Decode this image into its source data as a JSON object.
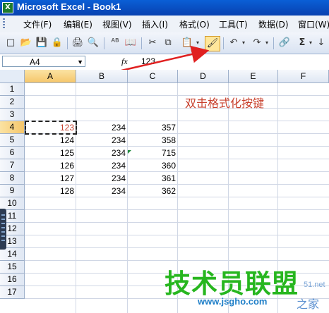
{
  "window": {
    "title": "Microsoft Excel - Book1",
    "app_icon": "X"
  },
  "menu": {
    "items": [
      "文件(F)",
      "编辑(E)",
      "视图(V)",
      "插入(I)",
      "格式(O)",
      "工具(T)",
      "数据(D)",
      "窗口(W)"
    ]
  },
  "toolbar": {
    "icons": [
      "new-icon",
      "open-icon",
      "save-icon",
      "permission-icon",
      "print-icon",
      "print-preview-icon",
      "spelling-icon",
      "research-icon",
      "cut-icon",
      "copy-icon",
      "paste-icon",
      "format-painter-icon",
      "undo-icon",
      "redo-icon",
      "hyperlink-icon",
      "autosum-icon",
      "sort-ascending-icon"
    ],
    "glyphs": {
      "new": "□",
      "open": "📂",
      "save": "💾",
      "permission": "🔒",
      "print": "🖨",
      "preview": "🔍",
      "spelling": "ᴬᴮ",
      "research": "📖",
      "cut": "✂",
      "copy": "⧉",
      "paste": "📋",
      "painter": "🖌",
      "undo": "↶",
      "redo": "↷",
      "hyperlink": "🔗",
      "autosum": "Σ",
      "sort": "↓"
    },
    "selected": "format-painter"
  },
  "formula_bar": {
    "name_box": "A4",
    "fx": "fx",
    "value": "123"
  },
  "sheet": {
    "columns": [
      "A",
      "B",
      "C",
      "D",
      "E",
      "F"
    ],
    "selected_column": "A",
    "rows": [
      "1",
      "2",
      "3",
      "4",
      "5",
      "6",
      "7",
      "8",
      "9",
      "10",
      "11",
      "12",
      "13",
      "14",
      "15",
      "16",
      "17"
    ],
    "selected_row": "4",
    "active_cell": "A4",
    "cells": {
      "A4": "123",
      "B4": "234",
      "C4": "357",
      "A5": "124",
      "B5": "234",
      "C5": "358",
      "A6": "125",
      "B6": "234",
      "C6": "715",
      "A7": "126",
      "B7": "234",
      "C7": "360",
      "A8": "127",
      "B8": "234",
      "C8": "361",
      "A9": "128",
      "B9": "234",
      "C9": "362"
    },
    "active_cell_color": "#c8412e"
  },
  "annotation": {
    "text": "双击格式化按键",
    "color": "#c8412e"
  },
  "watermark": {
    "brand": "技术员联盟",
    "url": "www.jsgho.com",
    "suffix": "之家",
    "site_hint": "51.net"
  }
}
